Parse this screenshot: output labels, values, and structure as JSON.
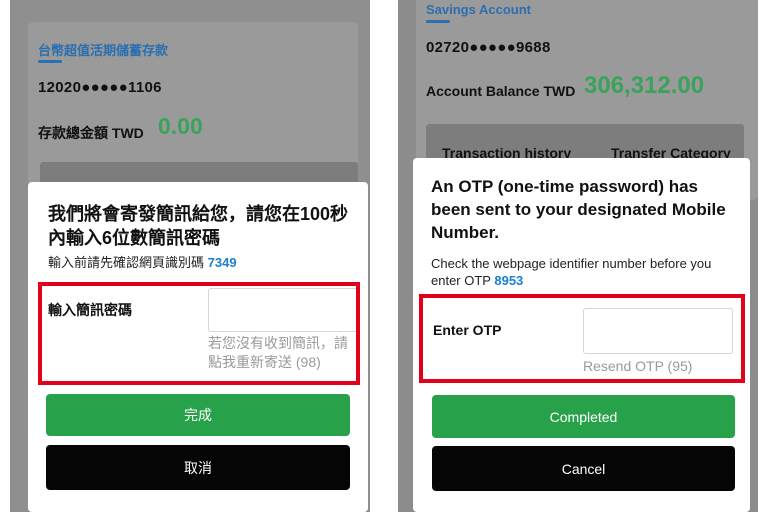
{
  "left": {
    "account_type": "台幣超值活期儲蓄存款",
    "account_number": "12020●●●●●1106",
    "balance_label": "存款總金額 TWD",
    "balance_value": "0.00",
    "modal": {
      "title": "我們將會寄發簡訊給您，請您在100秒內輸入6位數簡訊密碼",
      "subtitle_text": "輸入前請先確認網頁識別碼",
      "identifier_code": "7349",
      "field_label": "輸入簡訊密碼",
      "input_value": "",
      "resend_text": "若您沒有收到簡訊，請點我重新寄送 (98)",
      "confirm_label": "完成",
      "cancel_label": "取消"
    }
  },
  "right": {
    "account_type": "Savings Account",
    "account_number": "02720●●●●●9688",
    "balance_label": "Account Balance TWD",
    "balance_value": "306,312.00",
    "tabs": [
      "Transaction history",
      "Transfer Category"
    ],
    "modal": {
      "title": "An OTP (one-time password) has been sent to your designated Mobile Number.",
      "subtitle_text": "Check the webpage identifier number before you enter OTP",
      "identifier_code": "8953",
      "field_label": "Enter OTP",
      "input_value": "",
      "resend_text": "Resend OTP (95)",
      "confirm_label": "Completed",
      "cancel_label": "Cancel"
    }
  },
  "colors": {
    "accent_blue": "#2a6fb0",
    "balance_green": "#3aa35a",
    "button_green": "#27a24a",
    "button_black": "#050505",
    "highlight_red": "#e3001b",
    "code_blue": "#1a7fd0"
  }
}
